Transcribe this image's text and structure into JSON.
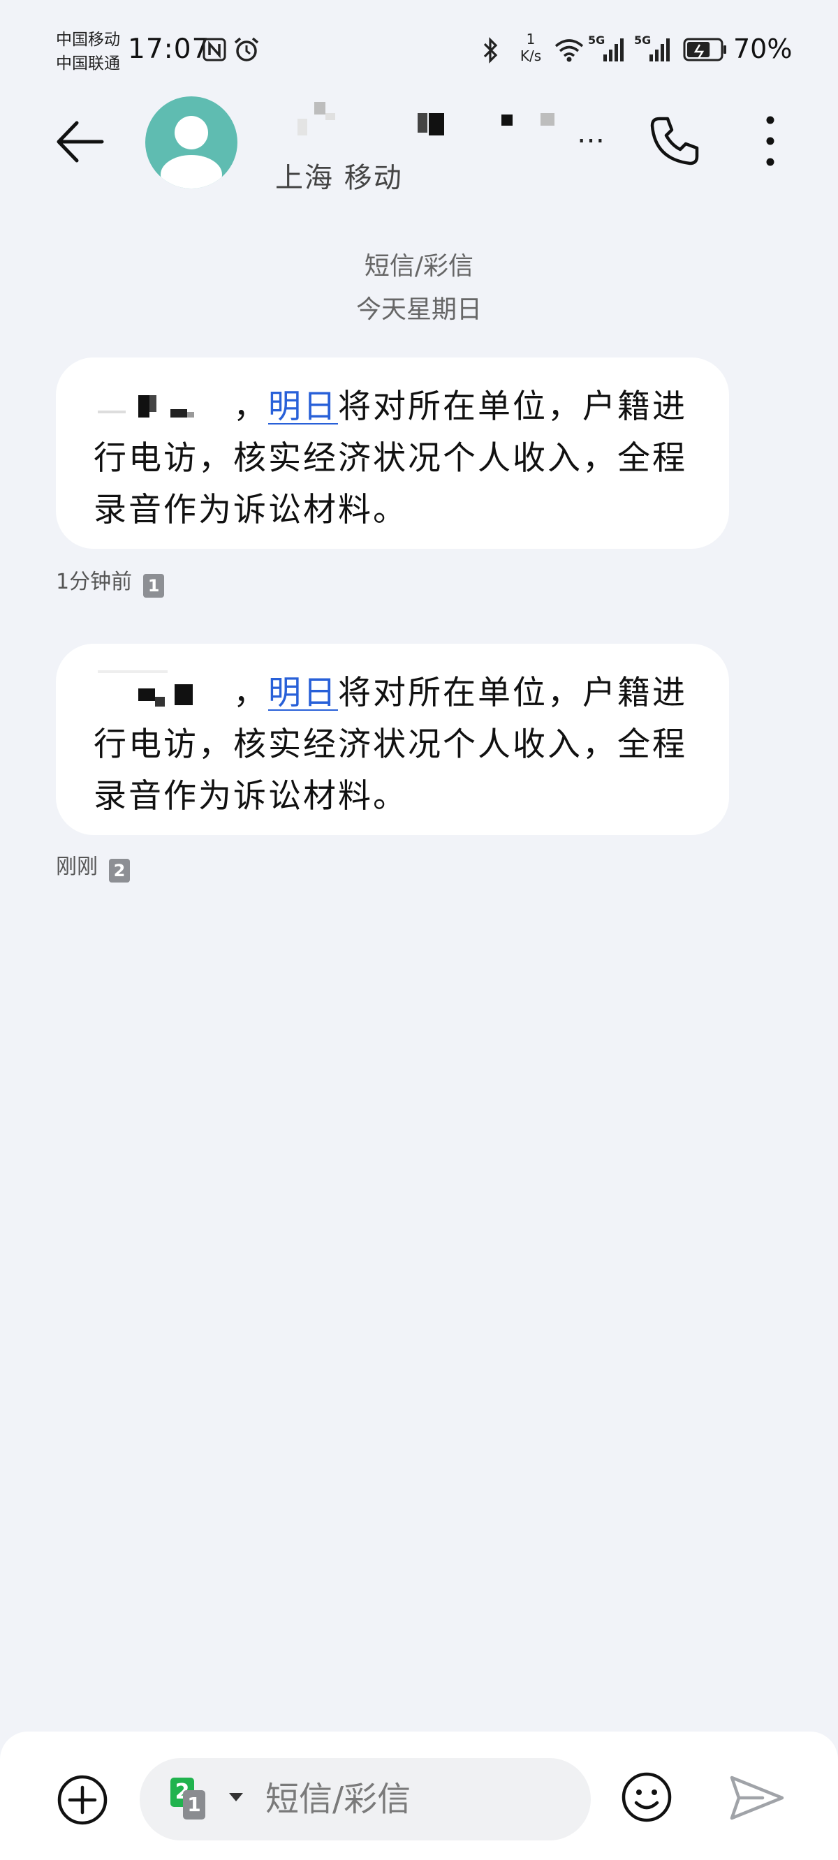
{
  "status_bar": {
    "carrier_1": "中国移动",
    "carrier_2": "中国联通",
    "time": "17:07",
    "speed_value": "1",
    "speed_unit": "K/s",
    "net_1": "5G",
    "net_2": "5G",
    "battery": "70%",
    "battery_level": 0.7
  },
  "header": {
    "contact_location": "上海 移动",
    "more": "…"
  },
  "thread": {
    "message_type": "短信/彩信",
    "date": "今天星期日"
  },
  "messages": [
    {
      "separator": "，",
      "link": "明日",
      "text_rest": "将对所在单位，户籍进行电访，核实经济状况个人收入，全程录音作为诉讼材料。",
      "time": "1分钟前",
      "sim": "1"
    },
    {
      "separator": "，",
      "link": "明日",
      "text_rest": "将对所在单位，户籍进行电访，核实经济状况个人收入，全程录音作为诉讼材料。",
      "time": "刚刚",
      "sim": "2"
    }
  ],
  "composer": {
    "placeholder": "短信/彩信",
    "sim_primary": "2",
    "sim_secondary": "1"
  },
  "icons": {
    "back": "back-arrow-icon",
    "call": "phone-icon",
    "menu": "more-vertical-icon",
    "add": "add-circle-icon",
    "emoji": "emoji-icon",
    "send": "send-icon"
  },
  "colors": {
    "background": "#f1f3f8",
    "bubble": "#ffffff",
    "link": "#2860d8",
    "avatar": "#5fbcb1",
    "sim_green": "#21b34e"
  }
}
